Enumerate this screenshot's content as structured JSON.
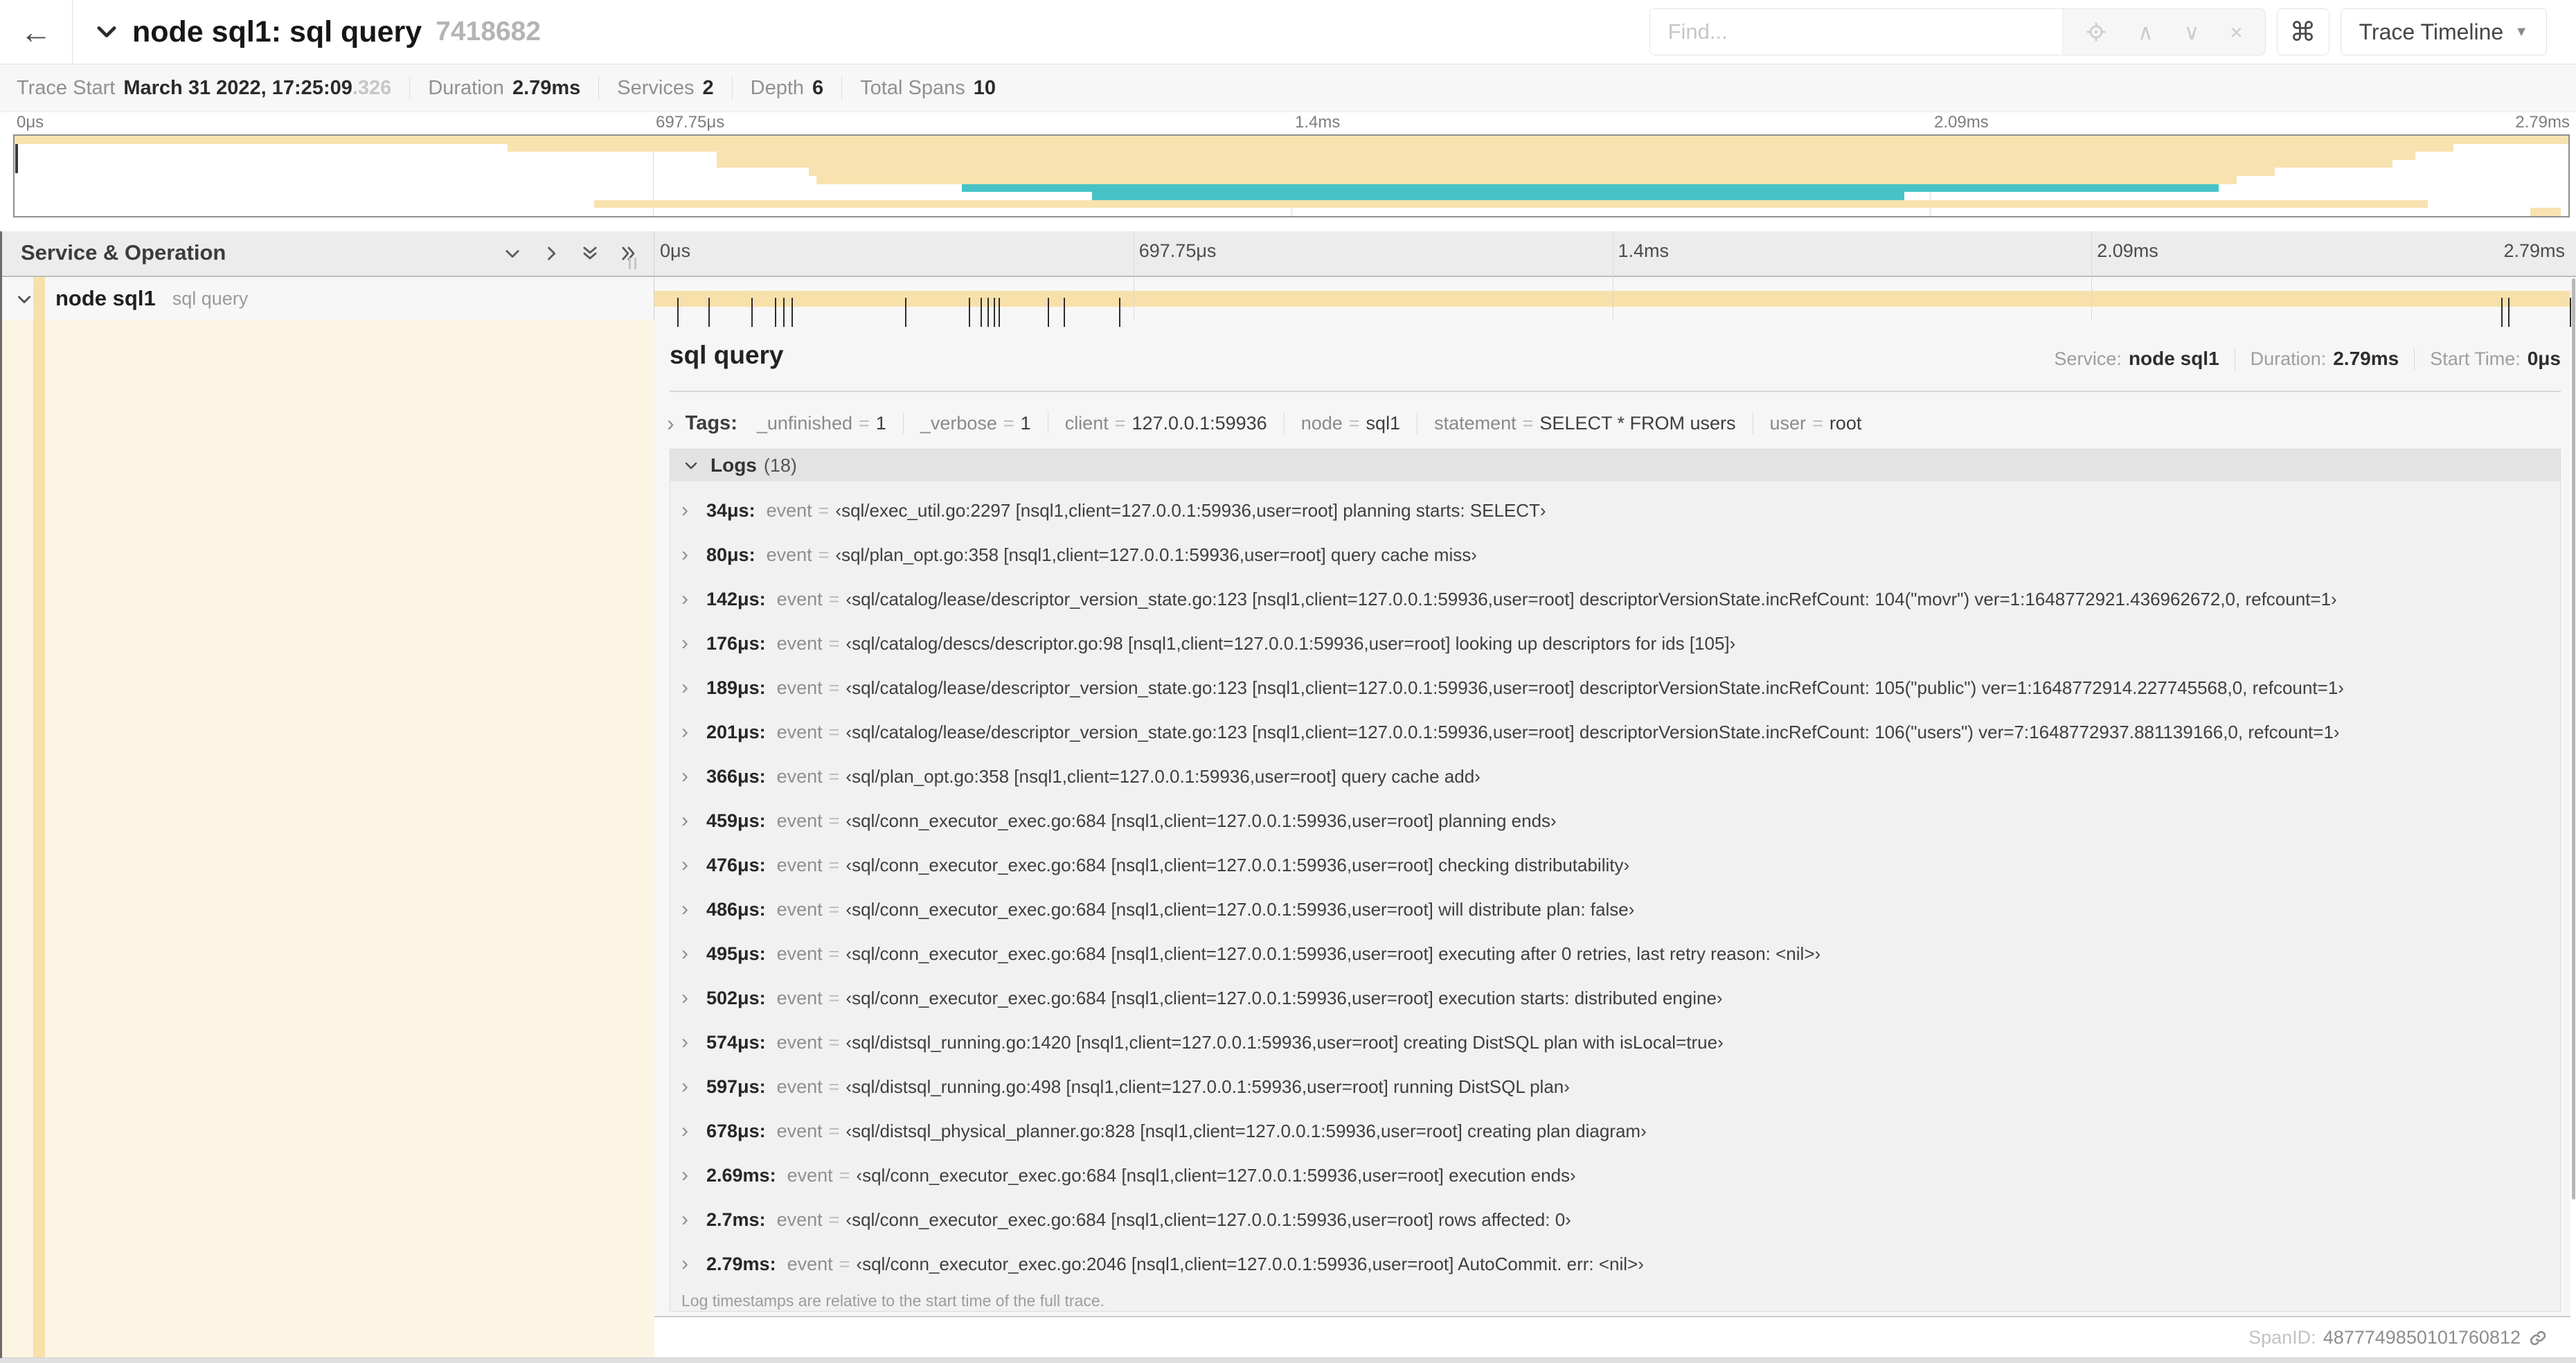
{
  "header": {
    "title": "node sql1: sql query",
    "trace_id": "7418682",
    "find_placeholder": "Find...",
    "shortcut_glyph": "⌘",
    "view_button": "Trace Timeline",
    "find_icons": [
      "locate",
      "prev",
      "next",
      "clear"
    ],
    "find_glyphs": {
      "prev": "∧",
      "next": "∨",
      "clear": "×"
    }
  },
  "stats": [
    {
      "label": "Trace Start",
      "value": "March 31 2022, 17:25:09",
      "muted": ".326"
    },
    {
      "label": "Duration",
      "value": "2.79ms"
    },
    {
      "label": "Services",
      "value": "2"
    },
    {
      "label": "Depth",
      "value": "6"
    },
    {
      "label": "Total Spans",
      "value": "10"
    }
  ],
  "colors": {
    "tan": "#f8e0ab",
    "tan_light": "#f8e2b0",
    "teal": "#47c3c5",
    "detail_bg": "#fdf5e4"
  },
  "minimap": {
    "ticks": [
      "0μs",
      "697.75μs",
      "1.4ms",
      "2.09ms",
      "2.79ms"
    ],
    "rows": [
      {
        "start": 0.0,
        "end": 1.0,
        "color": "tan"
      },
      {
        "start": 0.193,
        "end": 0.955,
        "color": "tan"
      },
      {
        "start": 0.275,
        "end": 0.94,
        "color": "tan"
      },
      {
        "start": 0.275,
        "end": 0.931,
        "color": "tan"
      },
      {
        "start": 0.311,
        "end": 0.885,
        "color": "tan"
      },
      {
        "start": 0.314,
        "end": 0.87,
        "color": "tan"
      },
      {
        "start": 0.371,
        "end": 0.863,
        "color": "teal"
      },
      {
        "start": 0.422,
        "end": 0.74,
        "color": "teal"
      },
      {
        "start": 0.227,
        "end": 0.945,
        "color": "tan"
      },
      {
        "start": 0.985,
        "end": 0.997,
        "color": "tan"
      }
    ]
  },
  "timeline": {
    "column_header": "Service & Operation",
    "ticks": [
      "0μs",
      "697.75μs",
      "1.4ms",
      "2.09ms",
      "2.79ms"
    ],
    "duration_us": 2790,
    "row": {
      "service": "node sql1",
      "operation": "sql query"
    }
  },
  "detail": {
    "title": "sql query",
    "meta": [
      {
        "label": "Service:",
        "value": "node sql1"
      },
      {
        "label": "Duration:",
        "value": "2.79ms"
      },
      {
        "label": "Start Time:",
        "value": "0μs"
      }
    ],
    "tags_label": "Tags:",
    "tags": [
      {
        "key": "_unfinished",
        "value": "1"
      },
      {
        "key": "_verbose",
        "value": "1"
      },
      {
        "key": "client",
        "value": "127.0.0.1:59936"
      },
      {
        "key": "node",
        "value": "sql1"
      },
      {
        "key": "statement",
        "value": "SELECT * FROM users"
      },
      {
        "key": "user",
        "value": "root"
      }
    ],
    "logs_label": "Logs",
    "logs_count": "(18)",
    "field_key": "event",
    "logs": [
      {
        "time": "34μs",
        "time_us": 34,
        "event": "sql/exec_util.go:2297 [nsql1,client=127.0.0.1:59936,user=root] planning starts: SELECT"
      },
      {
        "time": "80μs",
        "time_us": 80,
        "event": "sql/plan_opt.go:358 [nsql1,client=127.0.0.1:59936,user=root] query cache miss"
      },
      {
        "time": "142μs",
        "time_us": 142,
        "event": "sql/catalog/lease/descriptor_version_state.go:123 [nsql1,client=127.0.0.1:59936,user=root] descriptorVersionState.incRefCount: 104(\"movr\") ver=1:1648772921.436962672,0, refcount=1"
      },
      {
        "time": "176μs",
        "time_us": 176,
        "event": "sql/catalog/descs/descriptor.go:98 [nsql1,client=127.0.0.1:59936,user=root] looking up descriptors for ids [105]"
      },
      {
        "time": "189μs",
        "time_us": 189,
        "event": "sql/catalog/lease/descriptor_version_state.go:123 [nsql1,client=127.0.0.1:59936,user=root] descriptorVersionState.incRefCount: 105(\"public\") ver=1:1648772914.227745568,0, refcount=1"
      },
      {
        "time": "201μs",
        "time_us": 201,
        "event": "sql/catalog/lease/descriptor_version_state.go:123 [nsql1,client=127.0.0.1:59936,user=root] descriptorVersionState.incRefCount: 106(\"users\") ver=7:1648772937.881139166,0, refcount=1"
      },
      {
        "time": "366μs",
        "time_us": 366,
        "event": "sql/plan_opt.go:358 [nsql1,client=127.0.0.1:59936,user=root] query cache add"
      },
      {
        "time": "459μs",
        "time_us": 459,
        "event": "sql/conn_executor_exec.go:684 [nsql1,client=127.0.0.1:59936,user=root] planning ends"
      },
      {
        "time": "476μs",
        "time_us": 476,
        "event": "sql/conn_executor_exec.go:684 [nsql1,client=127.0.0.1:59936,user=root] checking distributability"
      },
      {
        "time": "486μs",
        "time_us": 486,
        "event": "sql/conn_executor_exec.go:684 [nsql1,client=127.0.0.1:59936,user=root] will distribute plan: false"
      },
      {
        "time": "495μs",
        "time_us": 495,
        "event": "sql/conn_executor_exec.go:684 [nsql1,client=127.0.0.1:59936,user=root] executing after 0 retries, last retry reason: <nil>"
      },
      {
        "time": "502μs",
        "time_us": 502,
        "event": "sql/conn_executor_exec.go:684 [nsql1,client=127.0.0.1:59936,user=root] execution starts: distributed engine"
      },
      {
        "time": "574μs",
        "time_us": 574,
        "event": "sql/distsql_running.go:1420 [nsql1,client=127.0.0.1:59936,user=root] creating DistSQL plan with isLocal=true"
      },
      {
        "time": "597μs",
        "time_us": 597,
        "event": "sql/distsql_running.go:498 [nsql1,client=127.0.0.1:59936,user=root] running DistSQL plan"
      },
      {
        "time": "678μs",
        "time_us": 678,
        "event": "sql/distsql_physical_planner.go:828 [nsql1,client=127.0.0.1:59936,user=root] creating plan diagram"
      },
      {
        "time": "2.69ms",
        "time_us": 2690,
        "event": "sql/conn_executor_exec.go:684 [nsql1,client=127.0.0.1:59936,user=root] execution ends"
      },
      {
        "time": "2.7ms",
        "time_us": 2700,
        "event": "sql/conn_executor_exec.go:684 [nsql1,client=127.0.0.1:59936,user=root] rows affected: 0"
      },
      {
        "time": "2.79ms",
        "time_us": 2790,
        "event": "sql/conn_executor_exec.go:2046 [nsql1,client=127.0.0.1:59936,user=root] AutoCommit. err: <nil>"
      }
    ],
    "footer_note": "Log timestamps are relative to the start time of the full trace.",
    "span_id_label": "SpanID:",
    "span_id": "4877749850101760812"
  }
}
